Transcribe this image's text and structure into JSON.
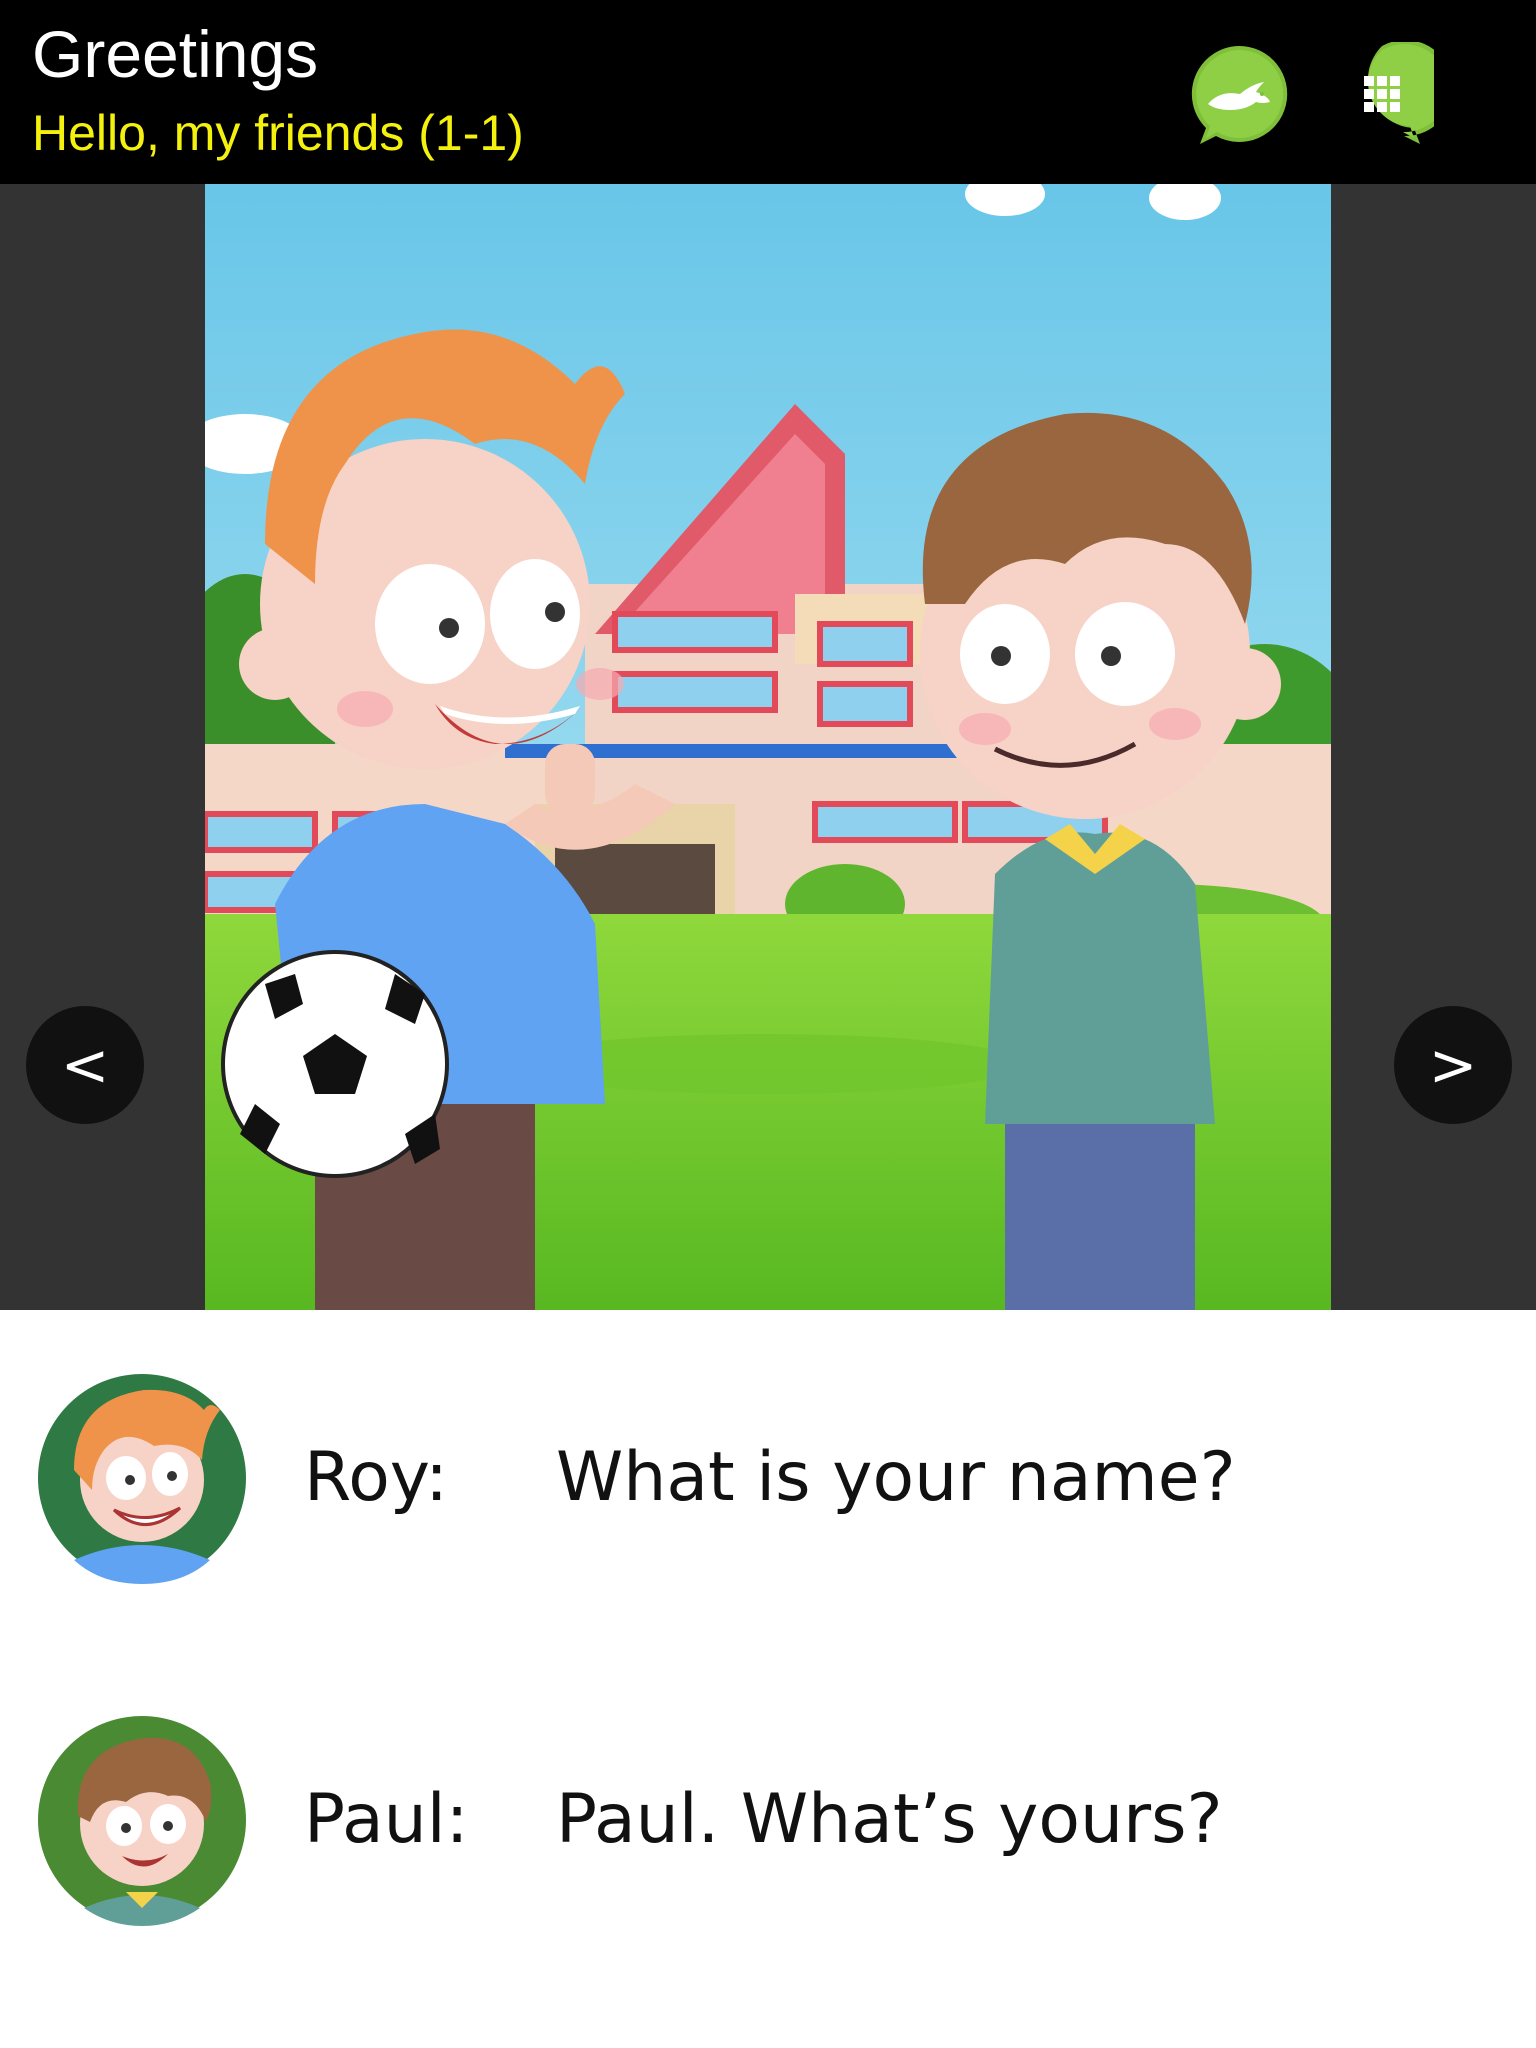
{
  "header": {
    "title": "Greetings",
    "subtitle": "Hello, my friends (1-1)",
    "buttons": [
      {
        "icon": "rabbit-speed-icon",
        "color": "#7fbf3a"
      },
      {
        "icon": "grid-menu-icon",
        "color": "#7fbf3a"
      }
    ]
  },
  "navigation": {
    "prev_label": "<",
    "next_label": ">"
  },
  "dialogue": [
    {
      "speaker": "Roy:",
      "text": "What is your name?"
    },
    {
      "speaker": "Paul:",
      "text": "Paul. What’s yours?"
    }
  ],
  "colors": {
    "header_bg": "#000000",
    "title": "#ffffff",
    "subtitle": "#f4f10e",
    "stage_bg": "#333333",
    "accent_green": "#7fbf3a"
  }
}
